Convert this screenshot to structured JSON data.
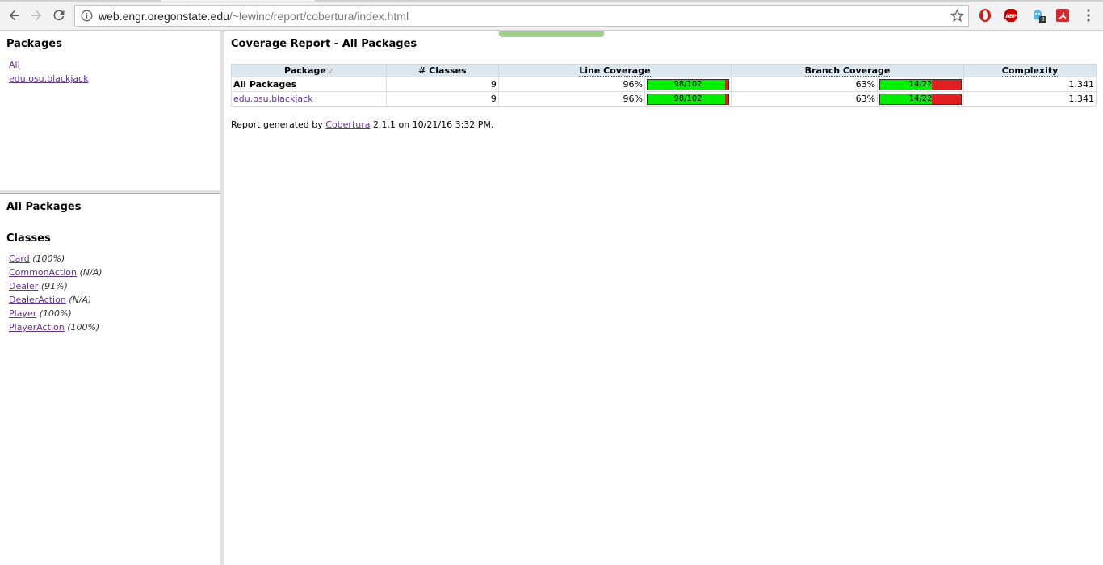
{
  "browser": {
    "url_host": "web.engr.oregonstate.edu",
    "url_path": "/~lewinc/report/cobertura/index.html",
    "extension_badge": "0",
    "abp_label": "ABP"
  },
  "packages_frame": {
    "title": "Packages",
    "items": [
      "All",
      "edu.osu.blackjack"
    ]
  },
  "classes_frame": {
    "package_title": "All Packages",
    "classes_title": "Classes",
    "classes": [
      {
        "name": "Card",
        "pct": "(100%)"
      },
      {
        "name": "CommonAction",
        "pct": "(N/A)"
      },
      {
        "name": "Dealer",
        "pct": "(91%)"
      },
      {
        "name": "DealerAction",
        "pct": "(N/A)"
      },
      {
        "name": "Player",
        "pct": "(100%)"
      },
      {
        "name": "PlayerAction",
        "pct": "(100%)"
      }
    ]
  },
  "report": {
    "title": "Coverage Report - All Packages",
    "headers": {
      "package": "Package",
      "classes": "# Classes",
      "line": "Line Coverage",
      "branch": "Branch Coverage",
      "complexity": "Complexity"
    },
    "rows": [
      {
        "package": "All Packages",
        "classes": "9",
        "line_pct": "96%",
        "line_frac": "98/102",
        "line_ratio": 0.96,
        "branch_pct": "63%",
        "branch_frac": "14/22",
        "branch_ratio": 0.636,
        "complexity": "1.341"
      },
      {
        "package": "edu.osu.blackjack",
        "classes": "9",
        "line_pct": "96%",
        "line_frac": "98/102",
        "line_ratio": 0.96,
        "branch_pct": "63%",
        "branch_frac": "14/22",
        "branch_ratio": 0.636,
        "complexity": "1.341"
      }
    ],
    "footer_prefix": "Report generated by",
    "footer_link": "Cobertura",
    "footer_suffix": "2.1.1 on 10/21/16 3:32 PM."
  },
  "colors": {
    "link": "#663399",
    "bar_covered": "#00ee00",
    "bar_uncovered": "#e02020",
    "header_bg": "#dde7ef"
  }
}
